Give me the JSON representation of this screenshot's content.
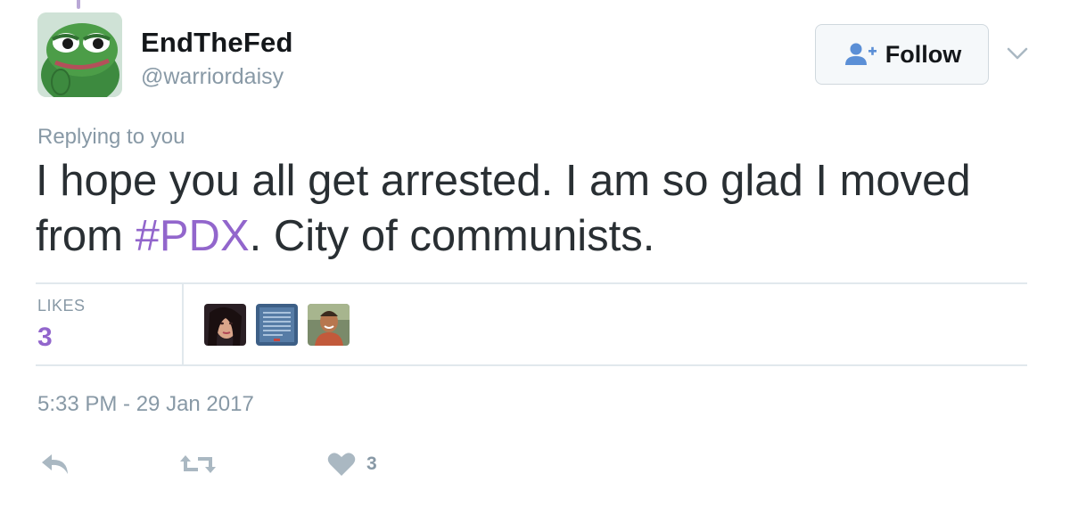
{
  "user": {
    "display_name": "EndTheFed",
    "handle": "@warriordaisy",
    "avatar_icon": "frog-avatar"
  },
  "follow_button": {
    "label": "Follow",
    "icon": "add-user-icon"
  },
  "more_menu_icon": "chevron-down-icon",
  "tweet": {
    "reply_context": "Replying to you",
    "text_before": "I hope you all get arrested. I am so glad I moved from ",
    "hashtag": "#PDX",
    "text_after": ". City of communists.",
    "timestamp": "5:33 PM - 29 Jan 2017"
  },
  "stats": {
    "likes_label": "LIKES",
    "likes_count": "3",
    "liker_avatars": [
      "liker-avatar-1",
      "liker-avatar-2",
      "liker-avatar-3"
    ]
  },
  "actions": {
    "reply_icon": "reply-icon",
    "retweet_icon": "retweet-icon",
    "like_icon": "heart-icon",
    "like_count": "3"
  },
  "colors": {
    "accent": "#9266cc",
    "secondary_text": "#8899a6",
    "primary_text": "#292f33",
    "follow_icon": "#5b8fd6",
    "divider": "#e1e8ed"
  }
}
